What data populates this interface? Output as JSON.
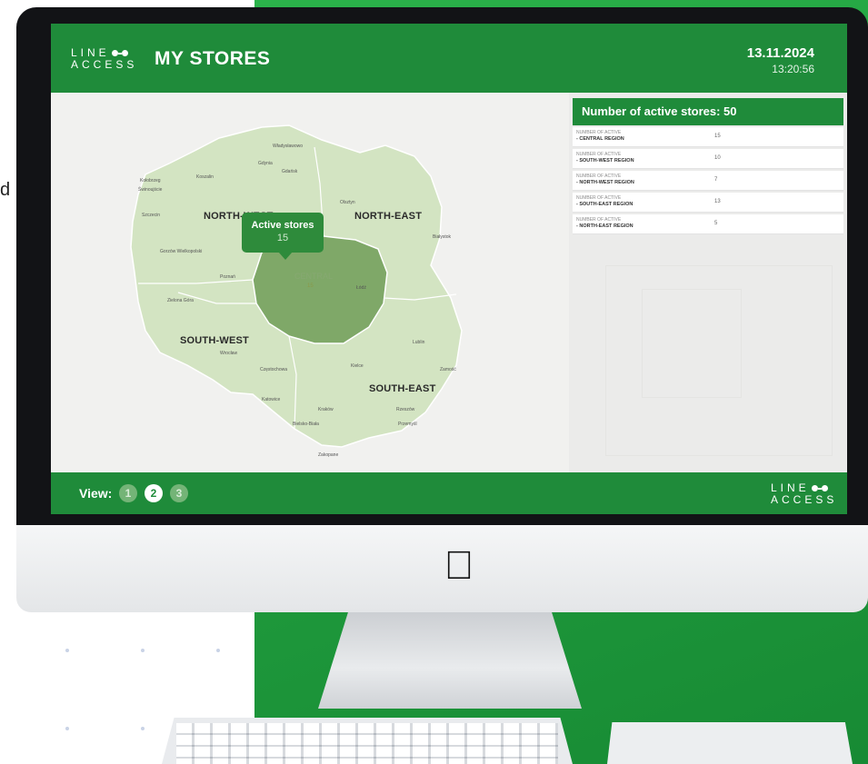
{
  "background": {
    "side_text": "d",
    "accent_color": "#1f9a3c"
  },
  "header": {
    "logo_line1": "LINE",
    "logo_line2": "ACCESS",
    "title": "MY STORES",
    "date": "13.11.2024",
    "time": "13:20:56",
    "bar_color": "#1f8b3a"
  },
  "map": {
    "regions": {
      "north_west": "NORTH-WEST",
      "north_east": "NORTH-EAST",
      "south_west": "SOUTH-WEST",
      "south_east": "SOUTH-EAST",
      "central": "CENTRAL"
    },
    "central_value": "15",
    "tooltip": {
      "title": "Active stores",
      "value": "15"
    },
    "cities": [
      "Władysławowo",
      "Gdynia",
      "Gdańsk",
      "Kołobrzeg",
      "Koszalin",
      "Świnoujście",
      "Szczecin",
      "Olsztyn",
      "Białystok",
      "Gorzów Wielkopolski",
      "Poznań",
      "Zielona Góra",
      "Wrocław",
      "Częstochowa",
      "Kielce",
      "Lublin",
      "Zamość",
      "Katowice",
      "Kraków",
      "Rzeszów",
      "Bielsko-Biała",
      "Przemyśl",
      "Zakopane",
      "Łódź"
    ],
    "colors": {
      "land": "#d3e4c2",
      "central": "#7fa868",
      "border": "#ffffff"
    }
  },
  "panel": {
    "title": "Number of active stores: 50",
    "rows": [
      {
        "label": "NUMBER OF ACTIVE",
        "region": "- CENTRAL REGION",
        "value": "15"
      },
      {
        "label": "NUMBER OF ACTIVE",
        "region": "- SOUTH-WEST REGION",
        "value": "10"
      },
      {
        "label": "NUMBER OF ACTIVE",
        "region": "- NORTH-WEST REGION",
        "value": "7"
      },
      {
        "label": "NUMBER OF ACTIVE",
        "region": "- SOUTH-EAST REGION",
        "value": "13"
      },
      {
        "label": "NUMBER OF ACTIVE",
        "region": "- NORTH-EAST REGION",
        "value": "5"
      }
    ]
  },
  "footer": {
    "view_label": "View:",
    "views": [
      "1",
      "2",
      "3"
    ],
    "active_view": "2",
    "logo_line1": "LINE",
    "logo_line2": "ACCESS"
  },
  "device": {
    "apple_glyph": ""
  }
}
